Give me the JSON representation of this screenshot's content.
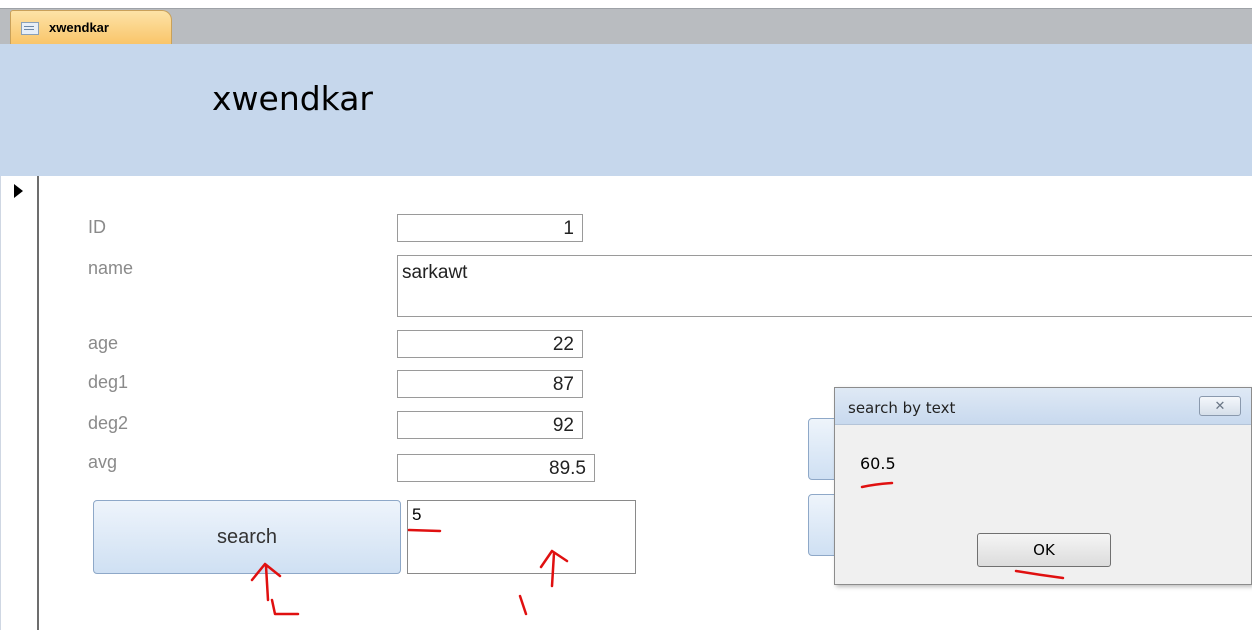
{
  "tab": {
    "label": "xwendkar"
  },
  "form": {
    "title": "xwendkar"
  },
  "fields": [
    {
      "label": "ID",
      "value": "1"
    },
    {
      "label": "name",
      "value": "sarkawt"
    },
    {
      "label": "age",
      "value": "22"
    },
    {
      "label": "deg1",
      "value": "87"
    },
    {
      "label": "deg2",
      "value": "92"
    },
    {
      "label": "avg",
      "value": "89.5"
    }
  ],
  "search": {
    "button_label": "search",
    "input_value": "5"
  },
  "dialog": {
    "title": "search by text",
    "close_label": "✕",
    "message": "60.5",
    "ok_label": "OK"
  },
  "colors": {
    "header_bg": "#c6d7ec",
    "tab_bg": "#f9c56a",
    "annotation": "#e01010"
  },
  "icons": [
    "form-tab-icon",
    "record-selector-arrow-icon",
    "close-icon"
  ]
}
